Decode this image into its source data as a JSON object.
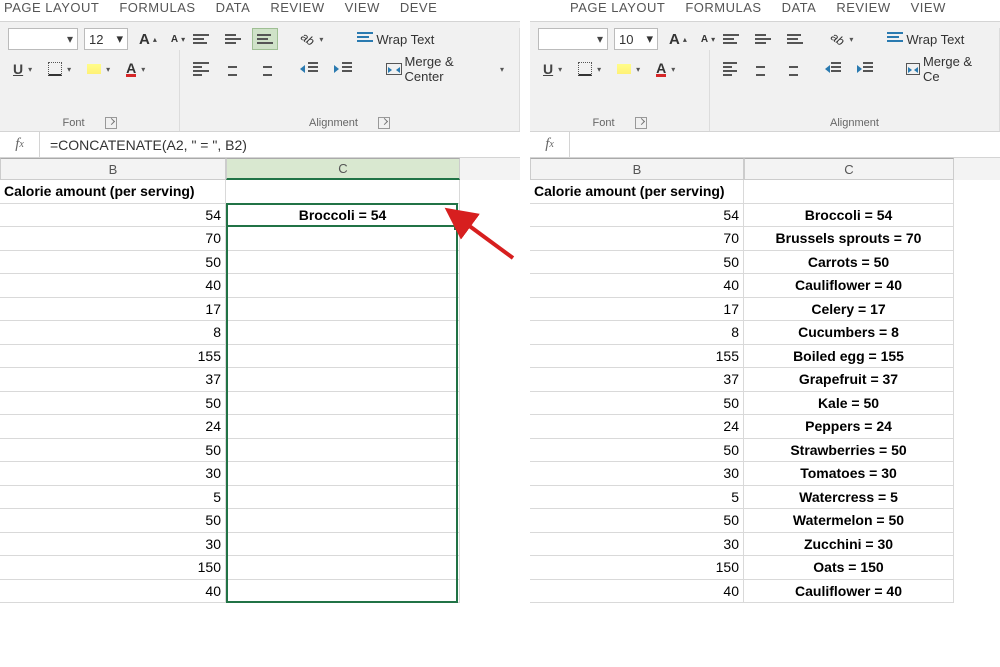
{
  "tabs": {
    "page_layout": "PAGE LAYOUT",
    "formulas": "FORMULAS",
    "data": "DATA",
    "review": "REVIEW",
    "view": "VIEW",
    "developer": "DEVE"
  },
  "ribbon": {
    "font_group": "Font",
    "alignment_group": "Alignment",
    "wrap_text": "Wrap Text",
    "merge_center": "Merge & Center",
    "merge_center_cut": "Merge & Ce",
    "underline": "U",
    "fontcolor": "A",
    "orient": "ab"
  },
  "font_size_left": "12",
  "font_size_right": "10",
  "left": {
    "formula": "=CONCATENATE(A2, \" = \", B2)",
    "col_b_label": "B",
    "col_c_label": "C",
    "header_b": "Calorie amount (per serving)",
    "rows": [
      {
        "b": "54",
        "c": "Broccoli = 54"
      },
      {
        "b": "70",
        "c": ""
      },
      {
        "b": "50",
        "c": ""
      },
      {
        "b": "40",
        "c": ""
      },
      {
        "b": "17",
        "c": ""
      },
      {
        "b": "8",
        "c": ""
      },
      {
        "b": "155",
        "c": ""
      },
      {
        "b": "37",
        "c": ""
      },
      {
        "b": "50",
        "c": ""
      },
      {
        "b": "24",
        "c": ""
      },
      {
        "b": "50",
        "c": ""
      },
      {
        "b": "30",
        "c": ""
      },
      {
        "b": "5",
        "c": ""
      },
      {
        "b": "50",
        "c": ""
      },
      {
        "b": "30",
        "c": ""
      },
      {
        "b": "150",
        "c": ""
      },
      {
        "b": "40",
        "c": ""
      }
    ]
  },
  "right": {
    "formula": "",
    "col_b_label": "B",
    "col_c_label": "C",
    "header_b": "Calorie amount (per serving)",
    "rows": [
      {
        "b": "54",
        "c": "Broccoli = 54"
      },
      {
        "b": "70",
        "c": "Brussels sprouts = 70"
      },
      {
        "b": "50",
        "c": "Carrots = 50"
      },
      {
        "b": "40",
        "c": "Cauliflower = 40"
      },
      {
        "b": "17",
        "c": "Celery = 17"
      },
      {
        "b": "8",
        "c": "Cucumbers = 8"
      },
      {
        "b": "155",
        "c": "Boiled egg = 155"
      },
      {
        "b": "37",
        "c": "Grapefruit = 37"
      },
      {
        "b": "50",
        "c": "Kale = 50"
      },
      {
        "b": "24",
        "c": "Peppers = 24"
      },
      {
        "b": "50",
        "c": "Strawberries = 50"
      },
      {
        "b": "30",
        "c": "Tomatoes = 30"
      },
      {
        "b": "5",
        "c": "Watercress = 5"
      },
      {
        "b": "50",
        "c": "Watermelon = 50"
      },
      {
        "b": "30",
        "c": "Zucchini = 30"
      },
      {
        "b": "150",
        "c": "Oats = 150"
      },
      {
        "b": "40",
        "c": "Cauliflower = 40"
      }
    ]
  }
}
